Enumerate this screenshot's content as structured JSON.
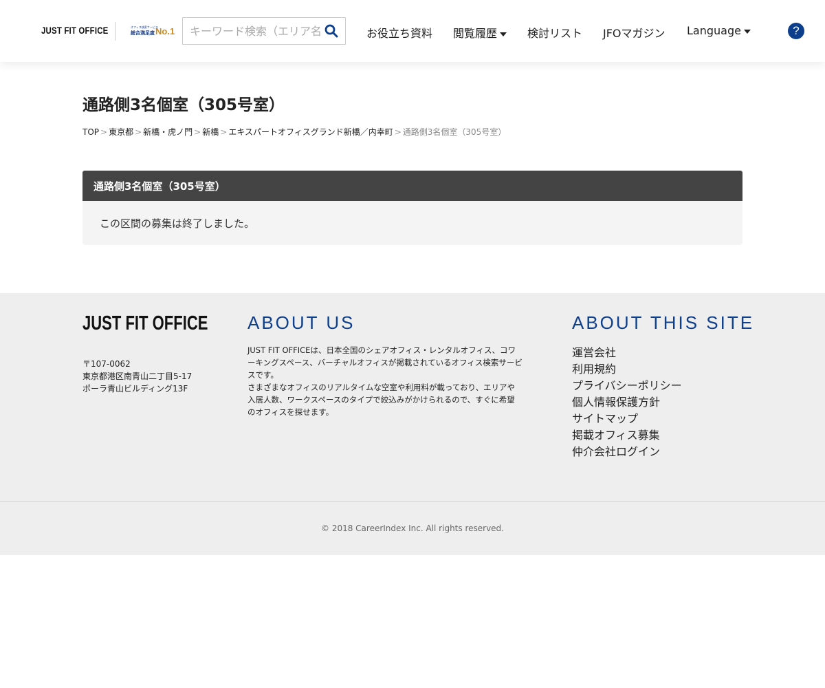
{
  "header": {
    "logo": "JUST FIT OFFICE",
    "award": {
      "line1": "オフィス検索サービス",
      "line2": "総合満足度",
      "badge": "No.1"
    },
    "search": {
      "placeholder": "キーワード検索（エリア名",
      "icon": "search-icon"
    },
    "nav": [
      {
        "label": "お役立ち資料",
        "dropdown": false
      },
      {
        "label": "閲覧履歴",
        "dropdown": true
      },
      {
        "label": "検討リスト",
        "dropdown": false
      },
      {
        "label": "JFOマガジン",
        "dropdown": false
      },
      {
        "label": "Language",
        "dropdown": true
      }
    ],
    "help": {
      "label": "?",
      "icon": "help-icon",
      "color": "#0e3f8c"
    }
  },
  "main": {
    "title": "通路側3名個室（305号室）",
    "breadcrumb": [
      "TOP",
      "東京都",
      "新橋・虎ノ門",
      "新橋",
      "エキスパートオフィスグランド新橋／内幸町"
    ],
    "breadcrumb_current": "通路側3名個室（305号室）",
    "breadcrumb_sep": ">",
    "panel": {
      "heading": "通路側3名個室（305号室）",
      "message": "この区間の募集は終了しました。"
    }
  },
  "footer": {
    "logo": "JUST FIT OFFICE",
    "address": [
      "〒107-0062",
      "東京都港区南青山二丁目5-17",
      "ポーラ青山ビルディング13F"
    ],
    "about_title": "ABOUT US",
    "about_text": [
      "JUST FIT OFFICEは、日本全国のシェアオフィス・レンタルオフィス、コワーキングスペース、バーチャルオフィスが掲載されているオフィス検索サービスです。",
      "さまざまなオフィスのリアルタイムな空室や利用料が載っており、エリアや入居人数、ワークスペースのタイプで絞込みがかけられるので、すぐに希望のオフィスを探せます。"
    ],
    "site_title": "ABOUT THIS SITE",
    "site_links": [
      "運営会社",
      "利用規約",
      "プライバシーポリシー",
      "個人情報保護方針",
      "サイトマップ",
      "掲載オフィス募集",
      "仲介会社ログイン"
    ],
    "copyright": "© 2018 CareerIndex Inc. All rights reserved."
  },
  "colors": {
    "accent": "#0e3f8c",
    "panel_header": "#444444",
    "footer_bg": "#eeeeee"
  }
}
